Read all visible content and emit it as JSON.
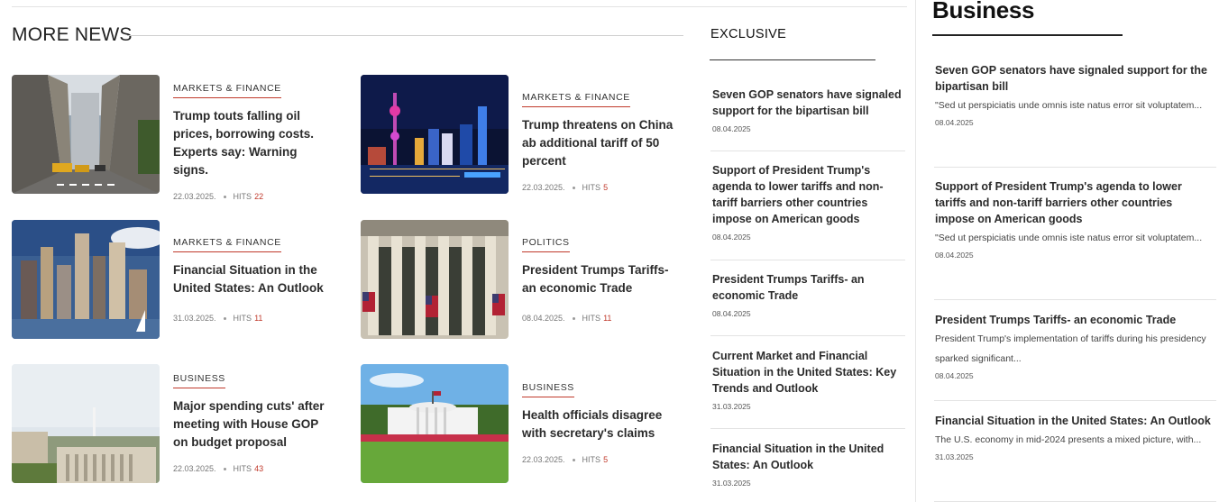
{
  "more_news": {
    "title": "MORE NEWS",
    "hits_label": "HITS",
    "cards": [
      {
        "category": "MARKETS & FINANCE",
        "headline": "Trump touts falling oil prices, borrowing costs. Experts say: Warning signs.",
        "date": "22.03.2025.",
        "hits": "22",
        "image": "city-street-photo"
      },
      {
        "category": "MARKETS & FINANCE",
        "headline": "Trump threatens on China ab additional tariff of 50 percent",
        "date": "22.03.2025.",
        "hits": "5",
        "image": "shanghai-skyline-photo"
      },
      {
        "category": "MARKETS & FINANCE",
        "headline": "Financial Situation in the United States: An Outlook",
        "date": "31.03.2025.",
        "hits": "11",
        "image": "nyc-skyline-photo"
      },
      {
        "category": "POLITICS",
        "headline": "President Trumps Tariffs- an economic Trade",
        "date": "08.04.2025.",
        "hits": "11",
        "image": "stock-exchange-photo"
      },
      {
        "category": "BUSINESS",
        "headline": "Major spending cuts' after meeting with House GOP on budget proposal",
        "date": "22.03.2025.",
        "hits": "43",
        "image": "washington-aerial-photo"
      },
      {
        "category": "BUSINESS",
        "headline": "Health officials disagree with secretary's claims",
        "date": "22.03.2025.",
        "hits": "5",
        "image": "white-house-photo"
      }
    ]
  },
  "exclusive": {
    "title": "EXCLUSIVE",
    "items": [
      {
        "title": "Seven GOP senators have signaled support for the bipartisan bill",
        "date": "08.04.2025"
      },
      {
        "title": "Support of President Trump's agenda to lower tariffs and non-tariff barriers other countries impose on American goods",
        "date": "08.04.2025"
      },
      {
        "title": "President Trumps Tariffs- an economic Trade",
        "date": "08.04.2025"
      },
      {
        "title": "Current Market and Financial Situation in the United States: Key Trends and Outlook",
        "date": "31.03.2025"
      },
      {
        "title": "Financial Situation in the United States: An Outlook",
        "date": "31.03.2025"
      }
    ]
  },
  "business": {
    "title": "Business",
    "items": [
      {
        "title": "Seven GOP senators have signaled support for the bipartisan bill",
        "excerpt": "\"Sed ut perspiciatis unde omnis iste natus error sit voluptatem...",
        "date": "08.04.2025"
      },
      {
        "title": "Support of President Trump's agenda to lower tariffs and non-tariff barriers other countries impose on American goods",
        "excerpt": "\"Sed ut perspiciatis unde omnis iste natus error sit voluptatem...",
        "date": "08.04.2025"
      },
      {
        "title": "President Trumps Tariffs- an economic Trade",
        "excerpt": "President Trump's implementation of tariffs during his presidency sparked significant...",
        "date": "08.04.2025"
      },
      {
        "title": "Financial Situation in the United States: An Outlook",
        "excerpt": "The U.S. economy in mid-2024 presents a mixed picture, with...",
        "date": "31.03.2025"
      }
    ]
  },
  "colors": {
    "accent": "#c0392b"
  }
}
